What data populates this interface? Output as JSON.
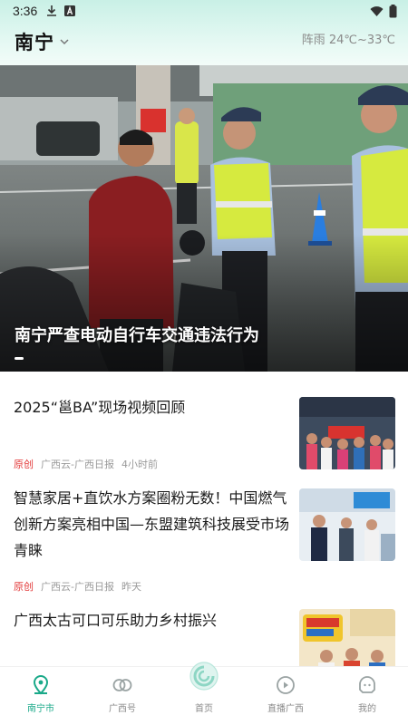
{
  "status_bar": {
    "time": "3:36"
  },
  "header": {
    "city": "南宁",
    "weather": "阵雨 24℃~33℃"
  },
  "hero": {
    "caption": "南宁严查电动自行车交通违法行为"
  },
  "news": [
    {
      "title": "2025“邕BA”现场视频回顾",
      "tag": "原创",
      "source": "广西云-广西日报",
      "time": "4小时前"
    },
    {
      "title": "智慧家居+直饮水方案圈粉无数！中国燃气创新方案亮相中国—东盟建筑科技展受市场青睐",
      "tag": "原创",
      "source": "广西云-广西日报",
      "time": "昨天"
    },
    {
      "title": "广西太古可口可乐助力乡村振兴"
    }
  ],
  "tabs": [
    {
      "label": "南宁市",
      "icon": "location-pin-icon"
    },
    {
      "label": "广西号",
      "icon": "rings-icon"
    },
    {
      "label": "首页",
      "icon": "home-swirl-icon"
    },
    {
      "label": "直播广西",
      "icon": "play-circle-icon"
    },
    {
      "label": "我的",
      "icon": "user-face-icon"
    }
  ],
  "colors": {
    "accent": "#1aa989",
    "tag_red": "#e23b3b",
    "header_bg": "#d4f3ea"
  }
}
